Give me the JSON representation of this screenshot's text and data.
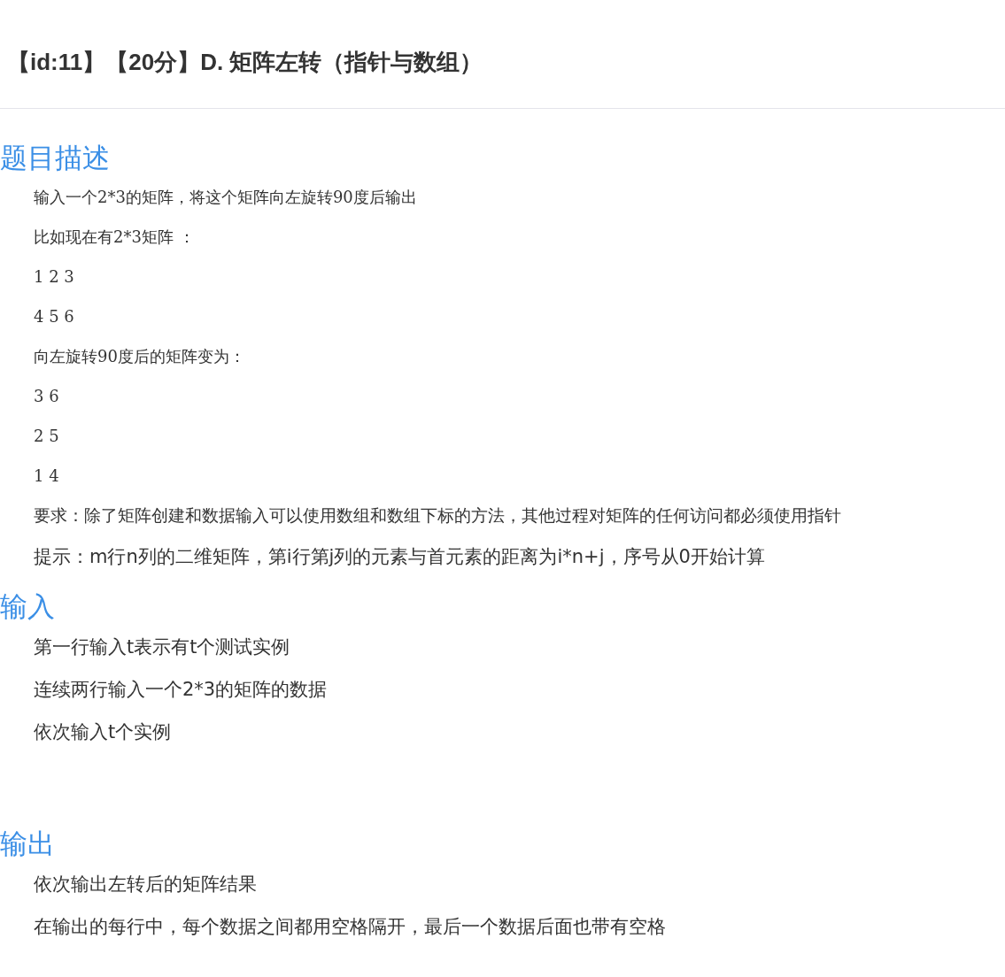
{
  "title": "【id:11】【20分】D. 矩阵左转（指针与数组）",
  "sections": [
    {
      "heading": "题目描述",
      "paragraphs": [
        {
          "kind": "serif",
          "text": "输入一个2*3的矩阵，将这个矩阵向左旋转90度后输出"
        },
        {
          "kind": "serif",
          "text": "比如现在有2*3矩阵 ："
        },
        {
          "kind": "serif",
          "text": "1 2 3"
        },
        {
          "kind": "serif",
          "text": "4 5 6"
        },
        {
          "kind": "serif",
          "text": "向左旋转90度后的矩阵变为："
        },
        {
          "kind": "serif",
          "text": "3 6"
        },
        {
          "kind": "serif",
          "text": "2 5"
        },
        {
          "kind": "serif",
          "text": "1 4"
        },
        {
          "kind": "sans-small",
          "text": "要求：除了矩阵创建和数据输入可以使用数组和数组下标的方法，其他过程对矩阵的任何访问都必须使用指针"
        },
        {
          "kind": "sans",
          "text": "提示：m行n列的二维矩阵，第i行第j列的元素与首元素的距离为i*n+j，序号从0开始计算"
        }
      ]
    },
    {
      "heading": "输入",
      "paragraphs": [
        {
          "kind": "sans",
          "text": "第一行输入t表示有t个测试实例"
        },
        {
          "kind": "sans",
          "text": "连续两行输入一个2*3的矩阵的数据"
        },
        {
          "kind": "sans",
          "text": "依次输入t个实例"
        }
      ]
    },
    {
      "heading": "输出",
      "paragraphs": [
        {
          "kind": "sans",
          "text": "依次输出左转后的矩阵结果"
        },
        {
          "kind": "sans",
          "text": "在输出的每行中，每个数据之间都用空格隔开，最后一个数据后面也带有空格"
        }
      ]
    }
  ]
}
